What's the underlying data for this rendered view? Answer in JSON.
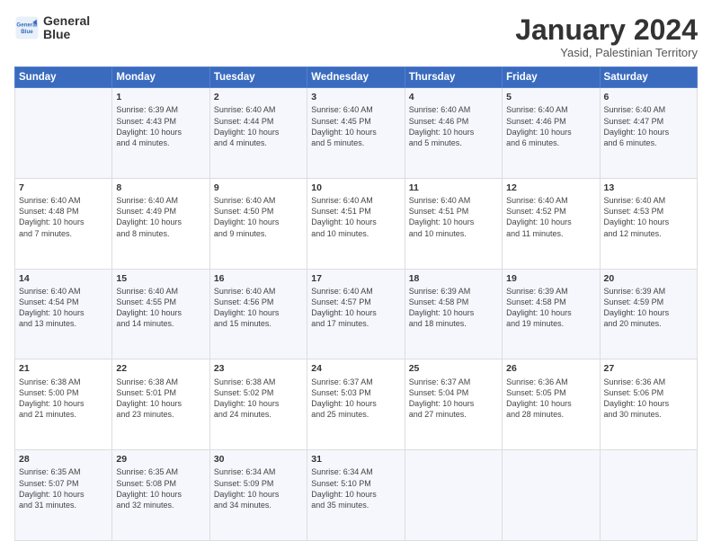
{
  "logo": {
    "line1": "General",
    "line2": "Blue"
  },
  "title": "January 2024",
  "subtitle": "Yasid, Palestinian Territory",
  "headers": [
    "Sunday",
    "Monday",
    "Tuesday",
    "Wednesday",
    "Thursday",
    "Friday",
    "Saturday"
  ],
  "weeks": [
    [
      {
        "day": "",
        "info": ""
      },
      {
        "day": "1",
        "info": "Sunrise: 6:39 AM\nSunset: 4:43 PM\nDaylight: 10 hours\nand 4 minutes."
      },
      {
        "day": "2",
        "info": "Sunrise: 6:40 AM\nSunset: 4:44 PM\nDaylight: 10 hours\nand 4 minutes."
      },
      {
        "day": "3",
        "info": "Sunrise: 6:40 AM\nSunset: 4:45 PM\nDaylight: 10 hours\nand 5 minutes."
      },
      {
        "day": "4",
        "info": "Sunrise: 6:40 AM\nSunset: 4:46 PM\nDaylight: 10 hours\nand 5 minutes."
      },
      {
        "day": "5",
        "info": "Sunrise: 6:40 AM\nSunset: 4:46 PM\nDaylight: 10 hours\nand 6 minutes."
      },
      {
        "day": "6",
        "info": "Sunrise: 6:40 AM\nSunset: 4:47 PM\nDaylight: 10 hours\nand 6 minutes."
      }
    ],
    [
      {
        "day": "7",
        "info": "Sunrise: 6:40 AM\nSunset: 4:48 PM\nDaylight: 10 hours\nand 7 minutes."
      },
      {
        "day": "8",
        "info": "Sunrise: 6:40 AM\nSunset: 4:49 PM\nDaylight: 10 hours\nand 8 minutes."
      },
      {
        "day": "9",
        "info": "Sunrise: 6:40 AM\nSunset: 4:50 PM\nDaylight: 10 hours\nand 9 minutes."
      },
      {
        "day": "10",
        "info": "Sunrise: 6:40 AM\nSunset: 4:51 PM\nDaylight: 10 hours\nand 10 minutes."
      },
      {
        "day": "11",
        "info": "Sunrise: 6:40 AM\nSunset: 4:51 PM\nDaylight: 10 hours\nand 10 minutes."
      },
      {
        "day": "12",
        "info": "Sunrise: 6:40 AM\nSunset: 4:52 PM\nDaylight: 10 hours\nand 11 minutes."
      },
      {
        "day": "13",
        "info": "Sunrise: 6:40 AM\nSunset: 4:53 PM\nDaylight: 10 hours\nand 12 minutes."
      }
    ],
    [
      {
        "day": "14",
        "info": "Sunrise: 6:40 AM\nSunset: 4:54 PM\nDaylight: 10 hours\nand 13 minutes."
      },
      {
        "day": "15",
        "info": "Sunrise: 6:40 AM\nSunset: 4:55 PM\nDaylight: 10 hours\nand 14 minutes."
      },
      {
        "day": "16",
        "info": "Sunrise: 6:40 AM\nSunset: 4:56 PM\nDaylight: 10 hours\nand 15 minutes."
      },
      {
        "day": "17",
        "info": "Sunrise: 6:40 AM\nSunset: 4:57 PM\nDaylight: 10 hours\nand 17 minutes."
      },
      {
        "day": "18",
        "info": "Sunrise: 6:39 AM\nSunset: 4:58 PM\nDaylight: 10 hours\nand 18 minutes."
      },
      {
        "day": "19",
        "info": "Sunrise: 6:39 AM\nSunset: 4:58 PM\nDaylight: 10 hours\nand 19 minutes."
      },
      {
        "day": "20",
        "info": "Sunrise: 6:39 AM\nSunset: 4:59 PM\nDaylight: 10 hours\nand 20 minutes."
      }
    ],
    [
      {
        "day": "21",
        "info": "Sunrise: 6:38 AM\nSunset: 5:00 PM\nDaylight: 10 hours\nand 21 minutes."
      },
      {
        "day": "22",
        "info": "Sunrise: 6:38 AM\nSunset: 5:01 PM\nDaylight: 10 hours\nand 23 minutes."
      },
      {
        "day": "23",
        "info": "Sunrise: 6:38 AM\nSunset: 5:02 PM\nDaylight: 10 hours\nand 24 minutes."
      },
      {
        "day": "24",
        "info": "Sunrise: 6:37 AM\nSunset: 5:03 PM\nDaylight: 10 hours\nand 25 minutes."
      },
      {
        "day": "25",
        "info": "Sunrise: 6:37 AM\nSunset: 5:04 PM\nDaylight: 10 hours\nand 27 minutes."
      },
      {
        "day": "26",
        "info": "Sunrise: 6:36 AM\nSunset: 5:05 PM\nDaylight: 10 hours\nand 28 minutes."
      },
      {
        "day": "27",
        "info": "Sunrise: 6:36 AM\nSunset: 5:06 PM\nDaylight: 10 hours\nand 30 minutes."
      }
    ],
    [
      {
        "day": "28",
        "info": "Sunrise: 6:35 AM\nSunset: 5:07 PM\nDaylight: 10 hours\nand 31 minutes."
      },
      {
        "day": "29",
        "info": "Sunrise: 6:35 AM\nSunset: 5:08 PM\nDaylight: 10 hours\nand 32 minutes."
      },
      {
        "day": "30",
        "info": "Sunrise: 6:34 AM\nSunset: 5:09 PM\nDaylight: 10 hours\nand 34 minutes."
      },
      {
        "day": "31",
        "info": "Sunrise: 6:34 AM\nSunset: 5:10 PM\nDaylight: 10 hours\nand 35 minutes."
      },
      {
        "day": "",
        "info": ""
      },
      {
        "day": "",
        "info": ""
      },
      {
        "day": "",
        "info": ""
      }
    ]
  ]
}
